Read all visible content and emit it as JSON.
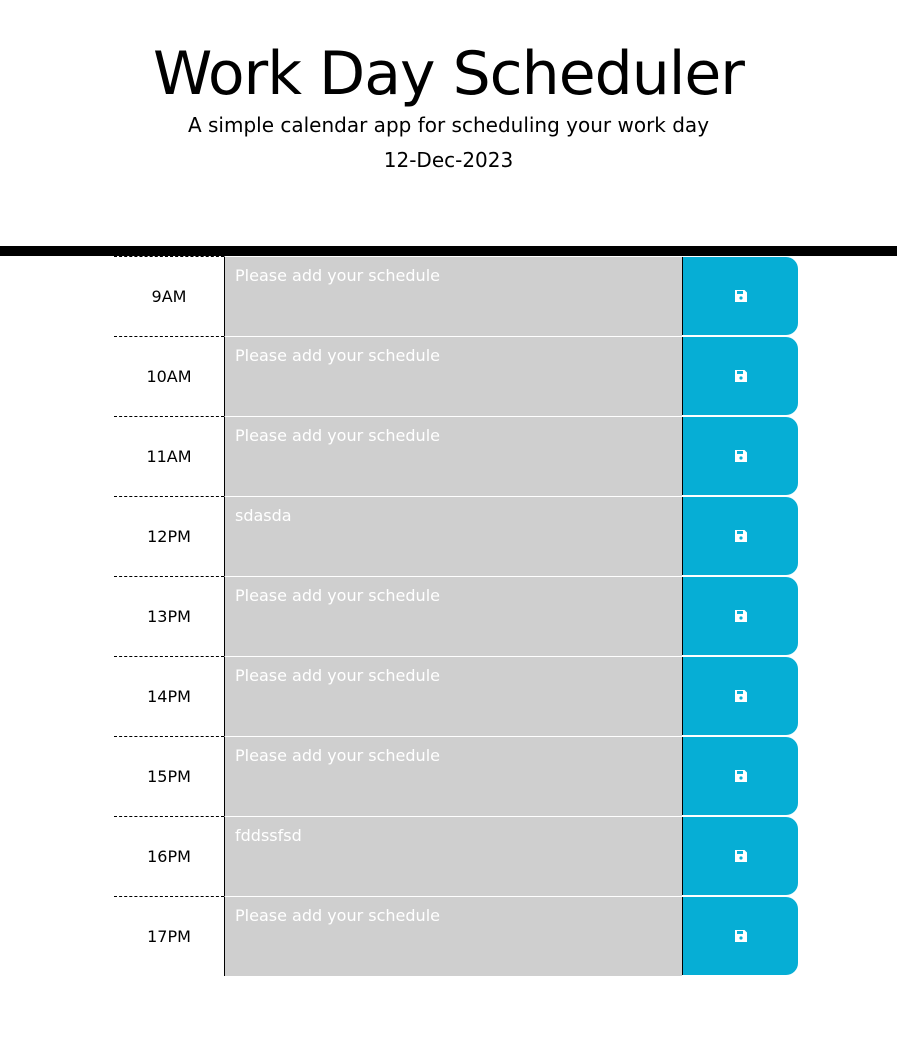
{
  "header": {
    "title": "Work Day Scheduler",
    "subtitle": "A simple calendar app for scheduling your work day",
    "date": "12-Dec-2023"
  },
  "schedule": {
    "rows": [
      {
        "hour": "9AM",
        "text": "Please add your schedule"
      },
      {
        "hour": "10AM",
        "text": "Please add your schedule"
      },
      {
        "hour": "11AM",
        "text": "Please add your schedule"
      },
      {
        "hour": "12PM",
        "text": "sdasda"
      },
      {
        "hour": "13PM",
        "text": "Please add your schedule"
      },
      {
        "hour": "14PM",
        "text": "Please add your schedule"
      },
      {
        "hour": "15PM",
        "text": "Please add your schedule"
      },
      {
        "hour": "16PM",
        "text": "fddssfsd"
      },
      {
        "hour": "17PM",
        "text": "Please add your schedule"
      }
    ],
    "save_icon": "save-icon"
  },
  "colors": {
    "save_button": "#06aed5",
    "entry_background": "#cfcfcf",
    "divider": "#000000"
  }
}
